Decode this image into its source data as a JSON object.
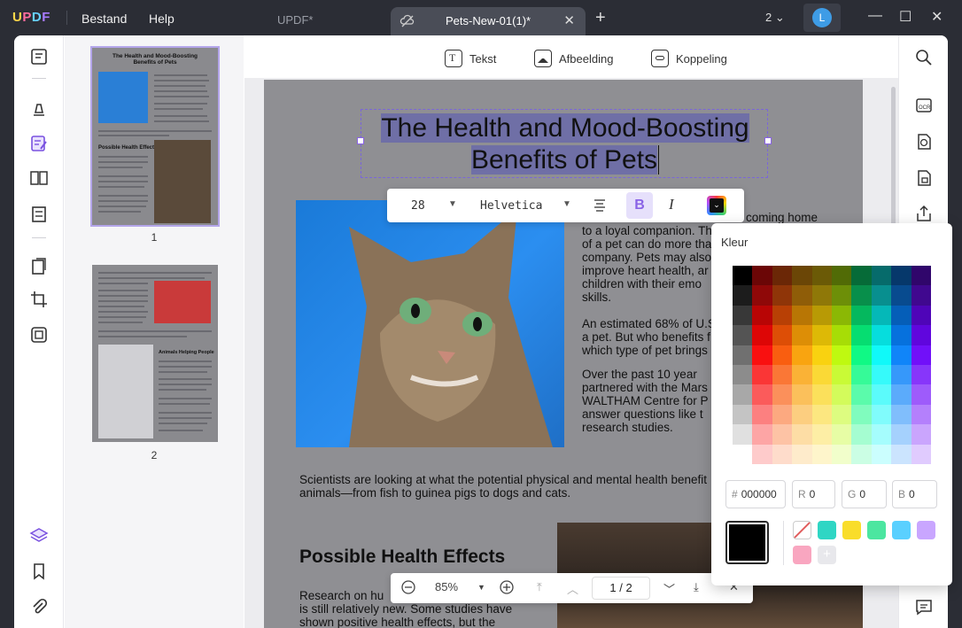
{
  "app": {
    "logo": "UPDF",
    "menu": [
      "Bestand",
      "Help"
    ],
    "tabs": [
      {
        "label": "UPDF*",
        "active": false
      },
      {
        "label": "Pets-New-01(1)*",
        "active": true
      }
    ],
    "window_count": "2",
    "user_initial": "L"
  },
  "edit_toolbar": {
    "text_label": "Tekst",
    "image_label": "Afbeelding",
    "link_label": "Koppeling"
  },
  "format_bar": {
    "font_size": "28",
    "font_family": "Helvetica",
    "bold_label": "B",
    "italic_label": "I"
  },
  "document": {
    "title_line1": "The Health and Mood-Boosting",
    "title_line2": "Benefits of Pets",
    "para1": [
      "coming home",
      "to a loyal companion. Th",
      "of a pet can do more tha",
      "company. Pets may also",
      "improve heart health, ar",
      "children with their emo",
      "skills."
    ],
    "para2": [
      "An estimated 68% of U.S",
      "a pet. But who benefits f",
      "which type of pet brings"
    ],
    "para3": [
      "Over the past 10 year",
      "partnered with the Mars",
      "WALTHAM Centre for P",
      "answer questions like t",
      "research studies."
    ],
    "para4": [
      "Scientists are looking at what the potential physical and mental health benefit",
      "animals—from fish to guinea pigs to dogs and cats."
    ],
    "section_heading": "Possible Health Effects",
    "para5": [
      "Research on hu",
      "is still relatively new. Some studies have",
      "shown positive health effects, but the"
    ]
  },
  "thumbnails": {
    "page1_label": "1",
    "page2_label": "2",
    "p1_title": "The Health and Mood-Boosting Benefits of Pets",
    "p1_section": "Possible Health Effects",
    "p2_section": "Animals Helping People"
  },
  "zoom_bar": {
    "zoom": "85%",
    "current_page": "1",
    "page_sep": "/",
    "total_pages": "2"
  },
  "color_picker": {
    "title": "Kleur",
    "hex_label": "#",
    "hex_value": "000000",
    "r_label": "R",
    "r_value": "0",
    "g_label": "G",
    "g_value": "0",
    "b_label": "B",
    "b_value": "0",
    "current_color": "#000000",
    "recent_colors": [
      "#2fd6c4",
      "#f9dd2b",
      "#4ce6a0",
      "#5ad0ff",
      "#c9a6ff",
      "#f9a6c0"
    ]
  }
}
